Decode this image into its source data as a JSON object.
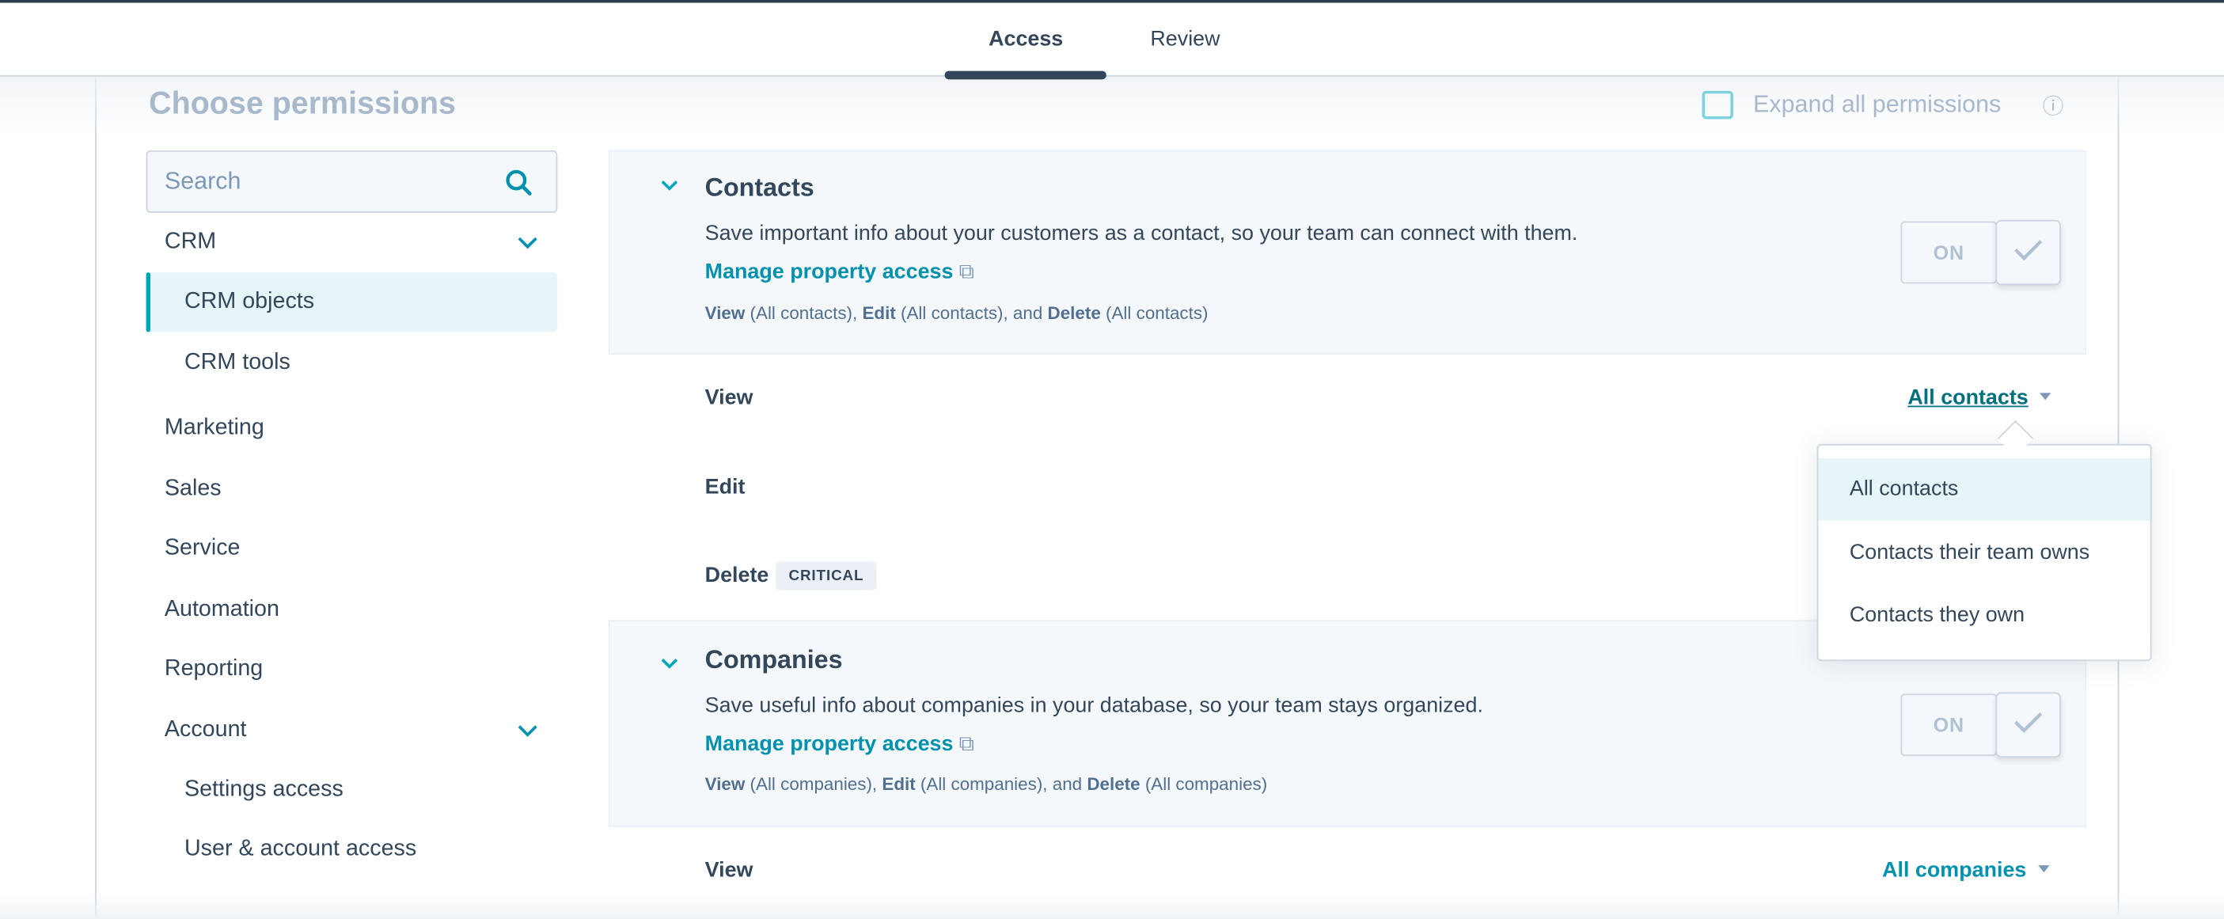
{
  "header": {
    "tabs": [
      {
        "label": "Access",
        "active": true
      },
      {
        "label": "Review",
        "active": false
      }
    ]
  },
  "page": {
    "title": "Choose permissions",
    "expand_all_label": "Expand all permissions"
  },
  "search": {
    "placeholder": "Search"
  },
  "sidebar": {
    "items": [
      {
        "label": "CRM",
        "expandable": true
      },
      {
        "label": "CRM objects",
        "selected": true
      },
      {
        "label": "CRM tools"
      },
      {
        "label": "Marketing"
      },
      {
        "label": "Sales"
      },
      {
        "label": "Service"
      },
      {
        "label": "Automation"
      },
      {
        "label": "Reporting"
      },
      {
        "label": "Account",
        "expandable": true
      },
      {
        "label": "Settings access"
      },
      {
        "label": "User & account access"
      }
    ]
  },
  "sections": [
    {
      "title": "Contacts",
      "description": "Save important info about your customers as a contact, so your team can connect with them.",
      "link": "Manage property access",
      "summary": {
        "view": "View",
        "view_scope": " (All contacts), ",
        "edit": "Edit",
        "edit_scope": " (All contacts), and ",
        "delete": "Delete",
        "delete_scope": " (All contacts)"
      },
      "toggle": "ON",
      "rows": [
        {
          "label": "View",
          "value": "All contacts"
        },
        {
          "label": "Edit"
        },
        {
          "label": "Delete",
          "badge": "CRITICAL"
        }
      ]
    },
    {
      "title": "Companies",
      "description": "Save useful info about companies in your database, so your team stays organized.",
      "link": "Manage property access",
      "summary": {
        "view": "View",
        "view_scope": " (All companies), ",
        "edit": "Edit",
        "edit_scope": " (All companies), and ",
        "delete": "Delete",
        "delete_scope": " (All companies)"
      },
      "toggle": "ON",
      "rows": [
        {
          "label": "View",
          "value": "All companies"
        }
      ]
    }
  ],
  "dropdown": {
    "options": [
      "All contacts",
      "Contacts their team owns",
      "Contacts they own"
    ],
    "selected": "All contacts"
  },
  "colors": {
    "accent": "#0091ae",
    "text": "#33475b",
    "selected_bg": "#e5f5f8",
    "border": "#cbd6e2"
  }
}
